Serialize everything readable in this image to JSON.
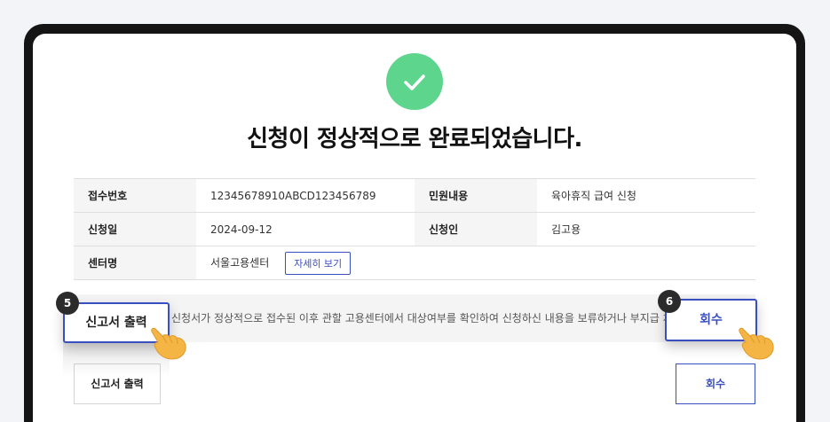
{
  "page": {
    "title": "신청이 정상적으로 완료되었습니다.",
    "success_icon": "check-icon",
    "success_color": "#5ed58d"
  },
  "info": {
    "receipt_no_label": "접수번호",
    "receipt_no": "12345678910ABCD123456789",
    "service_label": "민원내용",
    "service": "육아휴직 급여 신청",
    "date_label": "신청일",
    "date": "2024-09-12",
    "applicant_label": "신청인",
    "applicant": "김고용",
    "center_label": "센터명",
    "center": "서울고용센터",
    "detail_button": "자세히 보기"
  },
  "notice": {
    "text": "신청서가 정상적으로 접수된 이후 관할 고용센터에서 대상여부를 확인하여 신청하신 내용을 보류하거나 부지급 처리할 수 있습니다."
  },
  "buttons": {
    "print": "신고서 출력",
    "withdraw": "회수"
  },
  "callouts": {
    "print_step": "5",
    "print_label": "신고서 출력",
    "withdraw_step": "6",
    "withdraw_label": "회수"
  },
  "colors": {
    "accent": "#3a4fbf",
    "device_frame": "#151515"
  }
}
